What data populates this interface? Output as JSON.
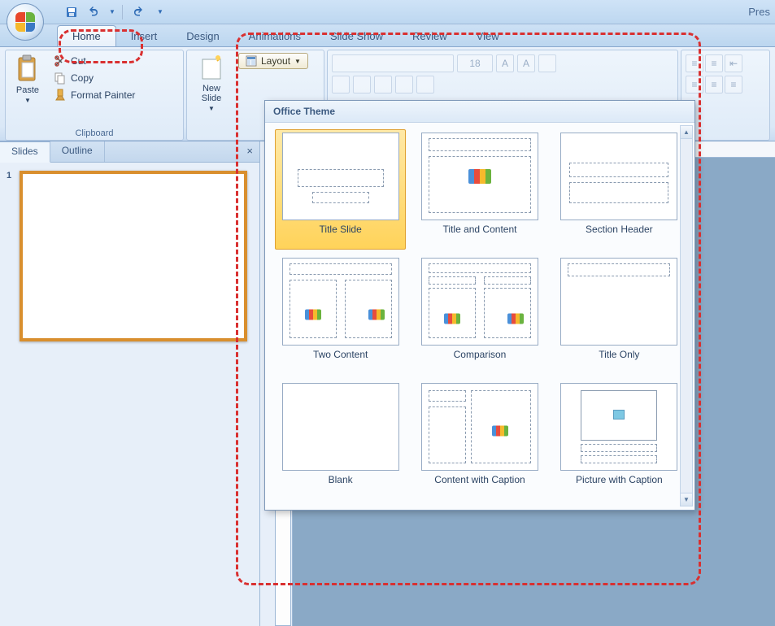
{
  "title_partial": "Pres",
  "tabs": [
    "Home",
    "Insert",
    "Design",
    "Animations",
    "Slide Show",
    "Review",
    "View"
  ],
  "active_tab": "Home",
  "clipboard": {
    "paste": "Paste",
    "cut": "Cut",
    "copy": "Copy",
    "format_painter": "Format Painter",
    "group_label": "Clipboard"
  },
  "slides_group": {
    "new_slide": "New\nSlide",
    "layout": "Layout"
  },
  "font": {
    "size_value": "18"
  },
  "sidepane": {
    "tab_slides": "Slides",
    "tab_outline": "Outline",
    "slide_number": "1"
  },
  "gallery": {
    "header": "Office Theme",
    "items": [
      "Title Slide",
      "Title and Content",
      "Section Header",
      "Two Content",
      "Comparison",
      "Title Only",
      "Blank",
      "Content with Caption",
      "Picture with Caption"
    ]
  }
}
